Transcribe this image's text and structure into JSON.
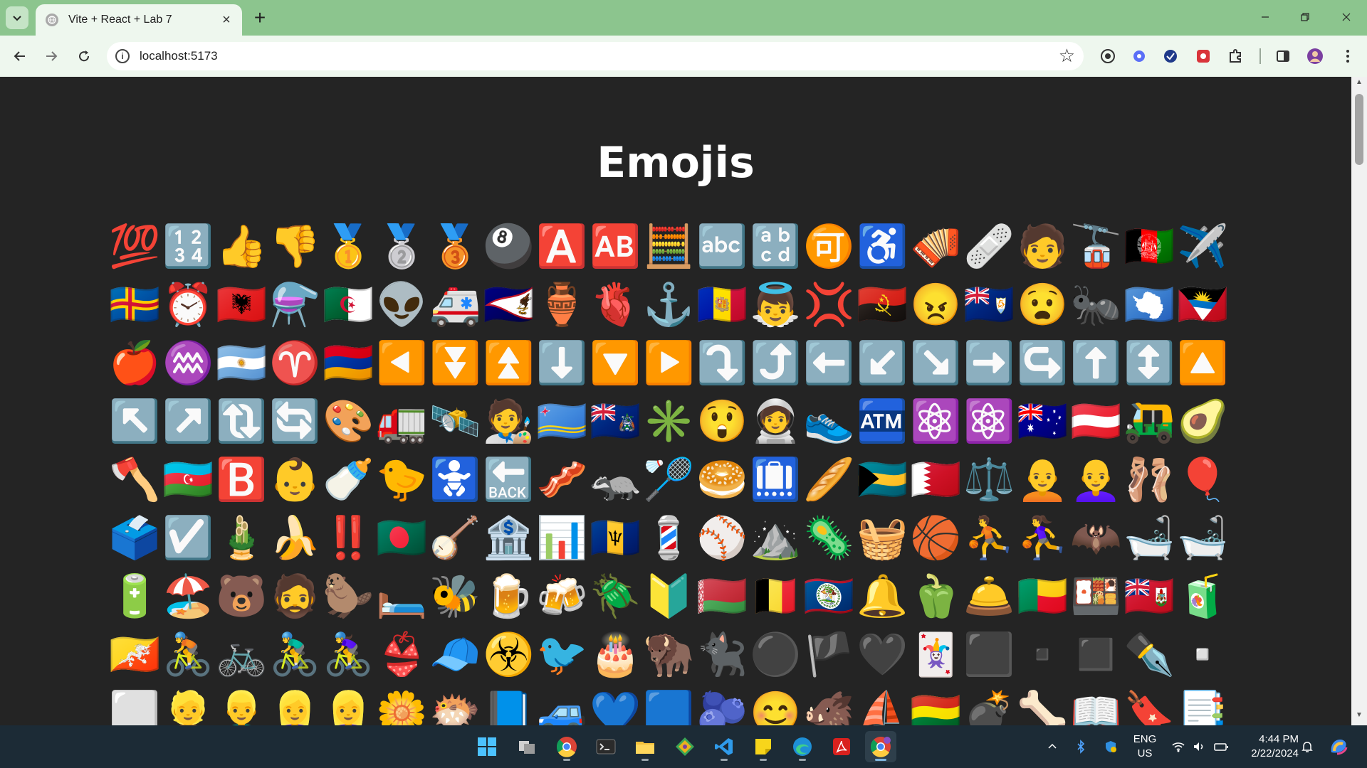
{
  "browser": {
    "tab_title": "Vite + React + Lab 7",
    "tab_close": "×",
    "new_tab": "+",
    "url": "localhost:5173"
  },
  "page": {
    "heading": "Emojis"
  },
  "emojis": [
    "💯",
    "🔢",
    "👍",
    "👎",
    "🥇",
    "🥈",
    "🥉",
    "🎱",
    "🅰️",
    "🆎",
    "🧮",
    "🔤",
    "🔡",
    "🉑",
    "♿",
    "🪗",
    "🩹",
    "🧑",
    "🚡",
    "🇦🇫",
    "✈️",
    "🇦🇽",
    "⏰",
    "🇦🇱",
    "⚗️",
    "🇩🇿",
    "👽",
    "🚑",
    "🇦🇸",
    "🏺",
    "🫀",
    "⚓",
    "🇦🇩",
    "👼",
    "💢",
    "🇦🇴",
    "😠",
    "🇦🇮",
    "😧",
    "🐜",
    "🇦🇶",
    "🇦🇬",
    "🍎",
    "♒",
    "🇦🇷",
    "♈",
    "🇦🇲",
    "◀️",
    "⏬",
    "⏫",
    "⬇️",
    "🔽",
    "▶️",
    "⤵️",
    "⤴️",
    "⬅️",
    "↙️",
    "↘️",
    "➡️",
    "↪️",
    "⬆️",
    "↕️",
    "🔼",
    "↖️",
    "↗️",
    "🔃",
    "🔄",
    "🎨",
    "🚛",
    "🛰️",
    "🧑‍🎨",
    "🇦🇼",
    "🇦🇨",
    "✳️",
    "😲",
    "🧑‍🚀",
    "👟",
    "🏧",
    "⚛️",
    "⚛️",
    "🇦🇺",
    "🇦🇹",
    "🛺",
    "🥑",
    "🪓",
    "🇦🇿",
    "🅱️",
    "👶",
    "🍼",
    "🐤",
    "🚼",
    "🔙",
    "🥓",
    "🦡",
    "🏸",
    "🥯",
    "🛄",
    "🥖",
    "🇧🇸",
    "🇧🇭",
    "⚖️",
    "🧑‍🦲",
    "👩‍🦲",
    "🩰",
    "🎈",
    "🗳️",
    "☑️",
    "🎍",
    "🍌",
    "‼️",
    "🇧🇩",
    "🪕",
    "🏦",
    "📊",
    "🇧🇧",
    "💈",
    "⚾",
    "⛰️",
    "🦠",
    "🧺",
    "🏀",
    "⛹️",
    "⛹️‍♀️",
    "🦇",
    "🛁",
    "🛁",
    "🔋",
    "🏖️",
    "🐻",
    "🧔",
    "🦫",
    "🛏️",
    "🐝",
    "🍺",
    "🍻",
    "🪲",
    "🔰",
    "🇧🇾",
    "🇧🇪",
    "🇧🇿",
    "🔔",
    "🫑",
    "🛎️",
    "🇧🇯",
    "🍱",
    "🇧🇲",
    "🧃",
    "🇧🇹",
    "🚴",
    "🚲",
    "🚴‍♂️",
    "🚴‍♀️",
    "👙",
    "🧢",
    "☣️",
    "🐦",
    "🎂",
    "🦬",
    "🐈‍⬛",
    "⚫",
    "🏴",
    "🖤",
    "🃏",
    "⬛",
    "▪️",
    "◼️",
    "✒️",
    "▫️",
    "⬜",
    "👱",
    "👱‍♂️",
    "👱‍♀️",
    "👱‍♀️",
    "🌼",
    "🐡",
    "📘",
    "🚙",
    "💙",
    "🟦",
    "🫐",
    "😊",
    "🐗",
    "⛵",
    "🇧🇴",
    "💣",
    "🦴",
    "📖",
    "🔖",
    "📑"
  ]
}
